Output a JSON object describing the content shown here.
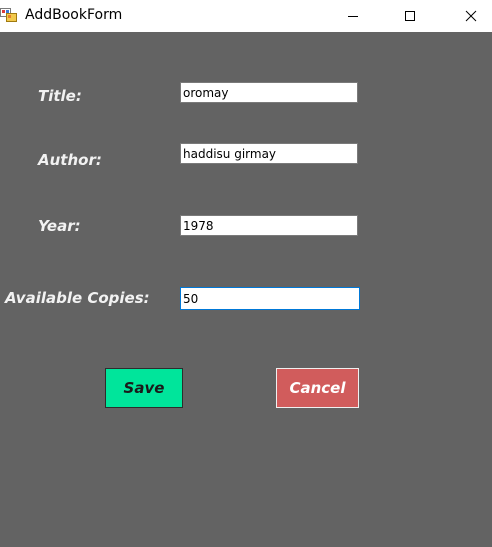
{
  "window": {
    "title": "AddBookForm",
    "background_color": "#636363",
    "icon": "winform-app-icon",
    "controls": {
      "minimize_icon": "minimize-icon",
      "maximize_icon": "maximize-icon",
      "close_icon": "close-icon"
    }
  },
  "form": {
    "title_label": "Title:",
    "title_value": "oromay",
    "author_label": "Author:",
    "author_value": "haddisu girmay",
    "year_label": "Year:",
    "year_value": "1978",
    "copies_label": "Available Copies:",
    "copies_value": "50"
  },
  "buttons": {
    "save_label": "Save",
    "save_color": "#00e59b",
    "cancel_label": "Cancel",
    "cancel_color": "#d15c5c"
  }
}
